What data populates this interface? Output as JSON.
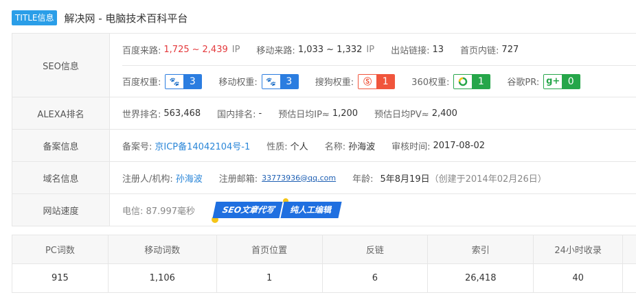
{
  "title": {
    "badge": "TITLE信息",
    "text": "解决网 - 电脑技术百科平台"
  },
  "seo": {
    "label": "SEO信息",
    "baidu_source": {
      "label": "百度来路:",
      "low": "1,725",
      "sep": "~",
      "high": "2,439",
      "unit": "IP"
    },
    "mobile_source": {
      "label": "移动来路:",
      "value": "1,033 ~ 1,332",
      "unit": "IP"
    },
    "outlinks": {
      "label": "出站链接:",
      "value": "13"
    },
    "home_inlinks": {
      "label": "首页内链:",
      "value": "727"
    },
    "ranks": [
      {
        "label": "百度权重:",
        "icon": "baidu-paw-icon",
        "value": "3"
      },
      {
        "label": "移动权重:",
        "icon": "baidu-paw-icon",
        "value": "3"
      },
      {
        "label": "搜狗权重:",
        "icon": "sogou-icon",
        "value": "1"
      },
      {
        "label": "360权重:",
        "icon": "360-icon",
        "value": "1"
      },
      {
        "label": "谷歌PR:",
        "icon": "google-plus-icon",
        "value": "0"
      }
    ]
  },
  "alexa": {
    "label": "ALEXA排名",
    "world": {
      "label": "世界排名:",
      "value": "563,468"
    },
    "domestic": {
      "label": "国内排名:",
      "value": "-"
    },
    "ip": {
      "label": "预估日均IP≈",
      "value": "1,200"
    },
    "pv": {
      "label": "预估日均PV≈",
      "value": "2,400"
    }
  },
  "icp": {
    "label": "备案信息",
    "number": {
      "label": "备案号:",
      "value": "京ICP备14042104号-1"
    },
    "nature": {
      "label": "性质:",
      "value": "个人"
    },
    "name": {
      "label": "名称:",
      "value": "孙海波"
    },
    "audit": {
      "label": "审核时间:",
      "value": "2017-08-02"
    }
  },
  "domain": {
    "label": "域名信息",
    "registrant": {
      "label": "注册人/机构:",
      "value": "孙海波"
    },
    "email": {
      "label": "注册邮箱:",
      "value": "33773936@qq.com"
    },
    "age": {
      "label": "年龄:",
      "value": "5年8月19日",
      "note": "（创建于2014年02月26日）"
    }
  },
  "speed": {
    "label": "网站速度",
    "telecom": "电信: 87.997毫秒",
    "promo_1": "SEO文章代写",
    "promo_2": "纯人工编辑"
  },
  "stats": {
    "headers": [
      "PC词数",
      "移动词数",
      "首页位置",
      "反链",
      "索引",
      "24小时收录"
    ],
    "values": [
      "915",
      "1,106",
      "1",
      "6",
      "26,418",
      "40"
    ]
  }
}
